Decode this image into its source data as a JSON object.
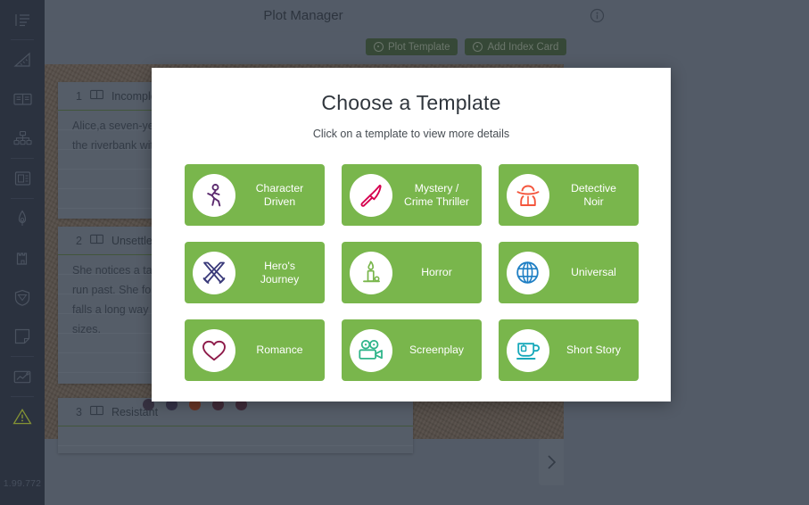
{
  "app": {
    "version_label": "1.99.772",
    "accent_green": "#79b64c",
    "chrome_bg": "#6a7380",
    "rail_bg": "#2c3444"
  },
  "topbar": {
    "title": "Plot Manager",
    "info_icon": "info-circle-icon"
  },
  "toolbar": {
    "plot_template_label": "Plot Template",
    "add_index_card_label": "Add Index Card"
  },
  "sidebar": {
    "items": [
      {
        "icon": "list-outline-icon",
        "sep_after": true
      },
      {
        "icon": "ruler-triangle-icon",
        "sep_after": false
      },
      {
        "icon": "open-book-icon",
        "sep_after": false
      },
      {
        "icon": "org-chart-icon",
        "sep_after": true
      },
      {
        "icon": "id-card-icon",
        "sep_after": true
      },
      {
        "icon": "pen-nib-icon",
        "sep_after": false
      },
      {
        "icon": "castle-tower-icon",
        "sep_after": false
      },
      {
        "icon": "shield-gem-icon",
        "sep_after": false
      },
      {
        "icon": "sticky-note-icon",
        "sep_after": true
      },
      {
        "icon": "line-chart-icon",
        "sep_after": true
      },
      {
        "icon": "warning-triangle-icon",
        "sep_after": false
      }
    ]
  },
  "board": {
    "cards": [
      {
        "number": "1",
        "status": "Incomplete",
        "icon": "open-book-icon",
        "text": "Alice,a seven-year-old girl,feels bored and sleepy while sitting on the riverbank with her older sister."
      },
      {
        "number": "2",
        "status": "Unsettled",
        "icon": "open-book-icon",
        "text": "She notices a talking,clothed White Rabbit with a pocket watch run past. She follows it down a rabbit hole where she suddenly falls a long way to a curious hall with many locked doors of all sizes."
      },
      {
        "number": "3",
        "status": "Resistant",
        "icon": "open-book-icon",
        "text": ""
      }
    ],
    "status_dots": [
      "#3d3247",
      "#3a3550",
      "#8a3a1e",
      "#4d2a3a",
      "#4a2a3c"
    ],
    "next_chevron_icon": "chevron-right-icon"
  },
  "modal": {
    "title": "Choose a Template",
    "subtitle": "Click on a template to view more details",
    "templates": [
      {
        "label": "Character\nDriven",
        "icon": "walking-person-icon",
        "color": "#5b2a6e"
      },
      {
        "label": "Mystery /\nCrime Thriller",
        "icon": "knife-icon",
        "color": "#d6004f"
      },
      {
        "label": "Detective\nNoir",
        "icon": "detective-hat-icon",
        "color": "#f4553c"
      },
      {
        "label": "Hero's\nJourney",
        "icon": "crossed-swords-icon",
        "color": "#3a3a7a"
      },
      {
        "label": "Horror",
        "icon": "candle-icon",
        "color": "#79b64c"
      },
      {
        "label": "Universal",
        "icon": "globe-icon",
        "color": "#1f7fc4"
      },
      {
        "label": "Romance",
        "icon": "heart-icon",
        "color": "#8e1b4a"
      },
      {
        "label": "Screenplay",
        "icon": "movie-camera-icon",
        "color": "#2fb58a"
      },
      {
        "label": "Short Story",
        "icon": "teacup-icon",
        "color": "#16a8ba"
      }
    ]
  }
}
